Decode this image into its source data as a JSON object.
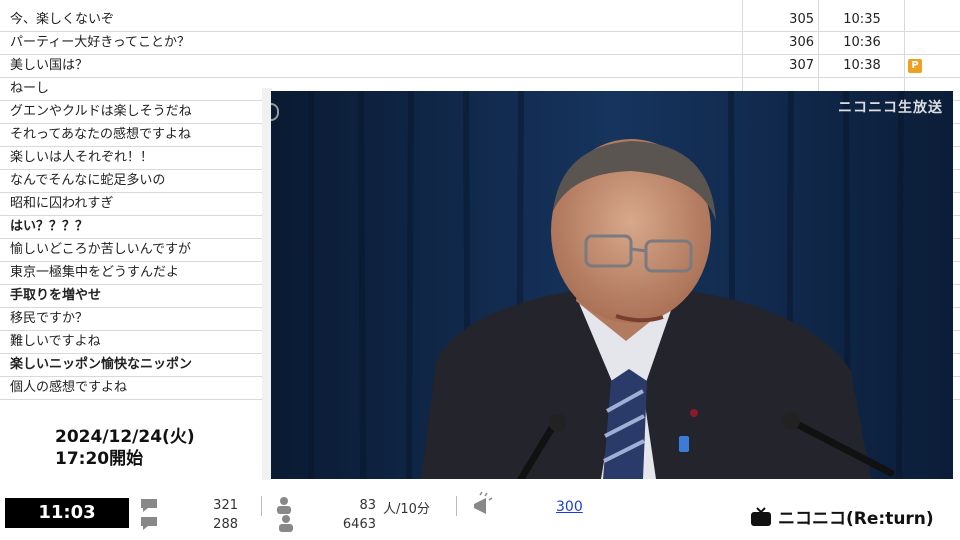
{
  "comments_partial_top": "",
  "comments": [
    {
      "text": "今、楽しくないぞ",
      "num": "305",
      "time": "10:35",
      "bold": false,
      "premium": false
    },
    {
      "text": "パーティー大好きってことか？",
      "num": "306",
      "time": "10:36",
      "bold": false,
      "premium": false
    },
    {
      "text": "美しい国は？",
      "num": "307",
      "time": "10:38",
      "bold": false,
      "premium": true
    },
    {
      "text": "ねーし",
      "bold": false
    },
    {
      "text": "グエンやクルドは楽しそうだね",
      "bold": false
    },
    {
      "text": "それってあなたの感想ですよね",
      "bold": false
    },
    {
      "text": "楽しいは人それぞれ！！",
      "bold": false
    },
    {
      "text": "なんでそんなに蛇足多いの",
      "bold": false
    },
    {
      "text": "昭和に囚われすぎ",
      "bold": false
    },
    {
      "text": "はい？？？？",
      "bold": true
    },
    {
      "text": "愉しいどころか苦しいんですが",
      "bold": false
    },
    {
      "text": "東京一極集中をどうすんだよ",
      "bold": false
    },
    {
      "text": "手取りを増やせ",
      "bold": true
    },
    {
      "text": "移民ですか？",
      "bold": false
    },
    {
      "text": "難しいですよね",
      "bold": false
    },
    {
      "text": "楽しいニッポン愉快なニッポン",
      "bold": true
    },
    {
      "text": "個人の感想ですよね",
      "bold": false
    }
  ],
  "premium_badge": "P",
  "video": {
    "watermark": "ニコニコ生放送"
  },
  "broadcast": {
    "date": "2024/12/24(火)",
    "start": "17:20開始"
  },
  "bottom": {
    "current_time": "11:03",
    "comments_count": "321",
    "comments_count_2": "288",
    "active_viewers": "83",
    "active_unit": "人/10分",
    "total_viewers": "6463",
    "ad_points": "300",
    "brand": "ニコニコ(Re:turn)"
  },
  "colors": {
    "accent_badge": "#f0a020",
    "link": "#1a3fcc",
    "video_bg": "#0c1e38"
  }
}
